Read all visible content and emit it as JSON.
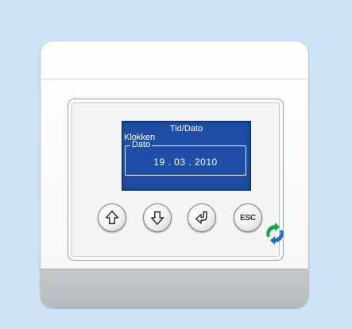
{
  "display": {
    "title": "Tid/Dato",
    "subtitle": "Klokken",
    "field_label": "Dato",
    "field_value": "19 . 03 . 2010"
  },
  "buttons": {
    "up_icon": "arrow-up-icon",
    "down_icon": "arrow-down-icon",
    "enter_icon": "enter-return-icon",
    "esc_label": "ESC"
  },
  "logo": {
    "icon": "recycle-arrows-logo",
    "colors": [
      "#1aa64a",
      "#1b6fc1"
    ]
  },
  "colors": {
    "background": "#cfe3f6",
    "lcd": "#1e4ea6",
    "lcd_text": "#ffffff",
    "device_band": "#bdc0c2"
  }
}
